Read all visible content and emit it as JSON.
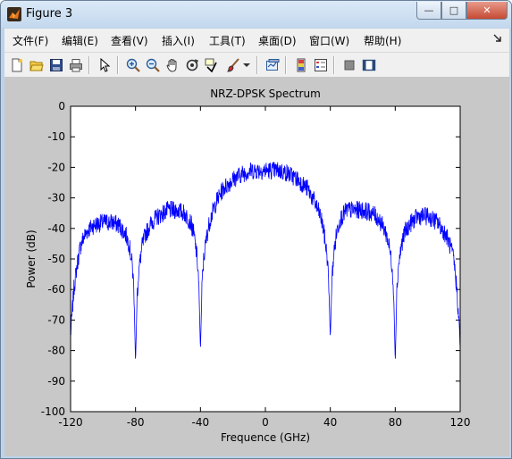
{
  "window": {
    "title": "Figure 3"
  },
  "window_buttons": {
    "minimize": "—",
    "maximize": "□",
    "close": "✕"
  },
  "menu": [
    {
      "label": "文件(F)"
    },
    {
      "label": "编辑(E)"
    },
    {
      "label": "查看(V)"
    },
    {
      "label": "插入(I)"
    },
    {
      "label": "工具(T)"
    },
    {
      "label": "桌面(D)"
    },
    {
      "label": "窗口(W)"
    },
    {
      "label": "帮助(H)"
    }
  ],
  "toolbar_icons": [
    "new-figure-icon",
    "open-file-icon",
    "save-icon",
    "print-icon",
    "pointer-icon",
    "zoom-in-icon",
    "zoom-out-icon",
    "pan-hand-icon",
    "rotate-3d-icon",
    "data-cursor-icon",
    "brush-icon",
    "brush-dropdown-icon",
    "link-plot-icon",
    "colorbar-icon",
    "legend-icon",
    "hide-plot-tools-icon",
    "show-plot-tools-icon"
  ],
  "colors": {
    "line": "#0000ff",
    "figure_bg": "#c8c8c8",
    "axes_bg": "#ffffff"
  },
  "chart_data": {
    "type": "line",
    "title": "NRZ-DPSK Spectrum",
    "xlabel": "Frequence (GHz)",
    "ylabel": "Power (dB)",
    "xlim": [
      -120,
      120
    ],
    "ylim": [
      -100,
      0
    ],
    "xticks": [
      -120,
      -80,
      -40,
      0,
      40,
      80,
      120
    ],
    "yticks": [
      0,
      -10,
      -20,
      -30,
      -40,
      -50,
      -60,
      -70,
      -80,
      -90,
      -100
    ],
    "grid": false,
    "series": [
      {
        "color": "#0000ff",
        "noise_dB": 3,
        "x": [
          -120,
          -118,
          -116,
          -114,
          -112,
          -110,
          -106,
          -100,
          -94,
          -90,
          -86,
          -84,
          -82,
          -81,
          -80,
          -79,
          -78,
          -76,
          -74,
          -70,
          -66,
          -60,
          -54,
          -50,
          -46,
          -44,
          -42,
          -41,
          -40,
          -39,
          -38,
          -36,
          -34,
          -30,
          -26,
          -20,
          -14,
          -8,
          0,
          8,
          14,
          20,
          26,
          30,
          34,
          36,
          38,
          39,
          40,
          41,
          42,
          44,
          46,
          50,
          54,
          60,
          66,
          70,
          74,
          76,
          78,
          79,
          80,
          81,
          82,
          84,
          86,
          90,
          94,
          100,
          106,
          110,
          112,
          114,
          116,
          118,
          120
        ],
        "y": [
          -75,
          -60,
          -52,
          -46,
          -43,
          -41,
          -39,
          -38,
          -38,
          -39,
          -42,
          -45,
          -52,
          -60,
          -84,
          -62,
          -54,
          -46,
          -42,
          -38,
          -36,
          -34,
          -34,
          -35,
          -38,
          -42,
          -50,
          -58,
          -80,
          -58,
          -50,
          -42,
          -37,
          -31,
          -27,
          -24,
          -22,
          -21,
          -21,
          -21,
          -22,
          -24,
          -27,
          -31,
          -36,
          -41,
          -49,
          -57,
          -76,
          -57,
          -49,
          -41,
          -37,
          -34,
          -34,
          -34,
          -35,
          -37,
          -41,
          -45,
          -52,
          -60,
          -84,
          -60,
          -52,
          -45,
          -41,
          -38,
          -36,
          -36,
          -38,
          -41,
          -43,
          -46,
          -50,
          -60,
          -78
        ]
      }
    ]
  }
}
